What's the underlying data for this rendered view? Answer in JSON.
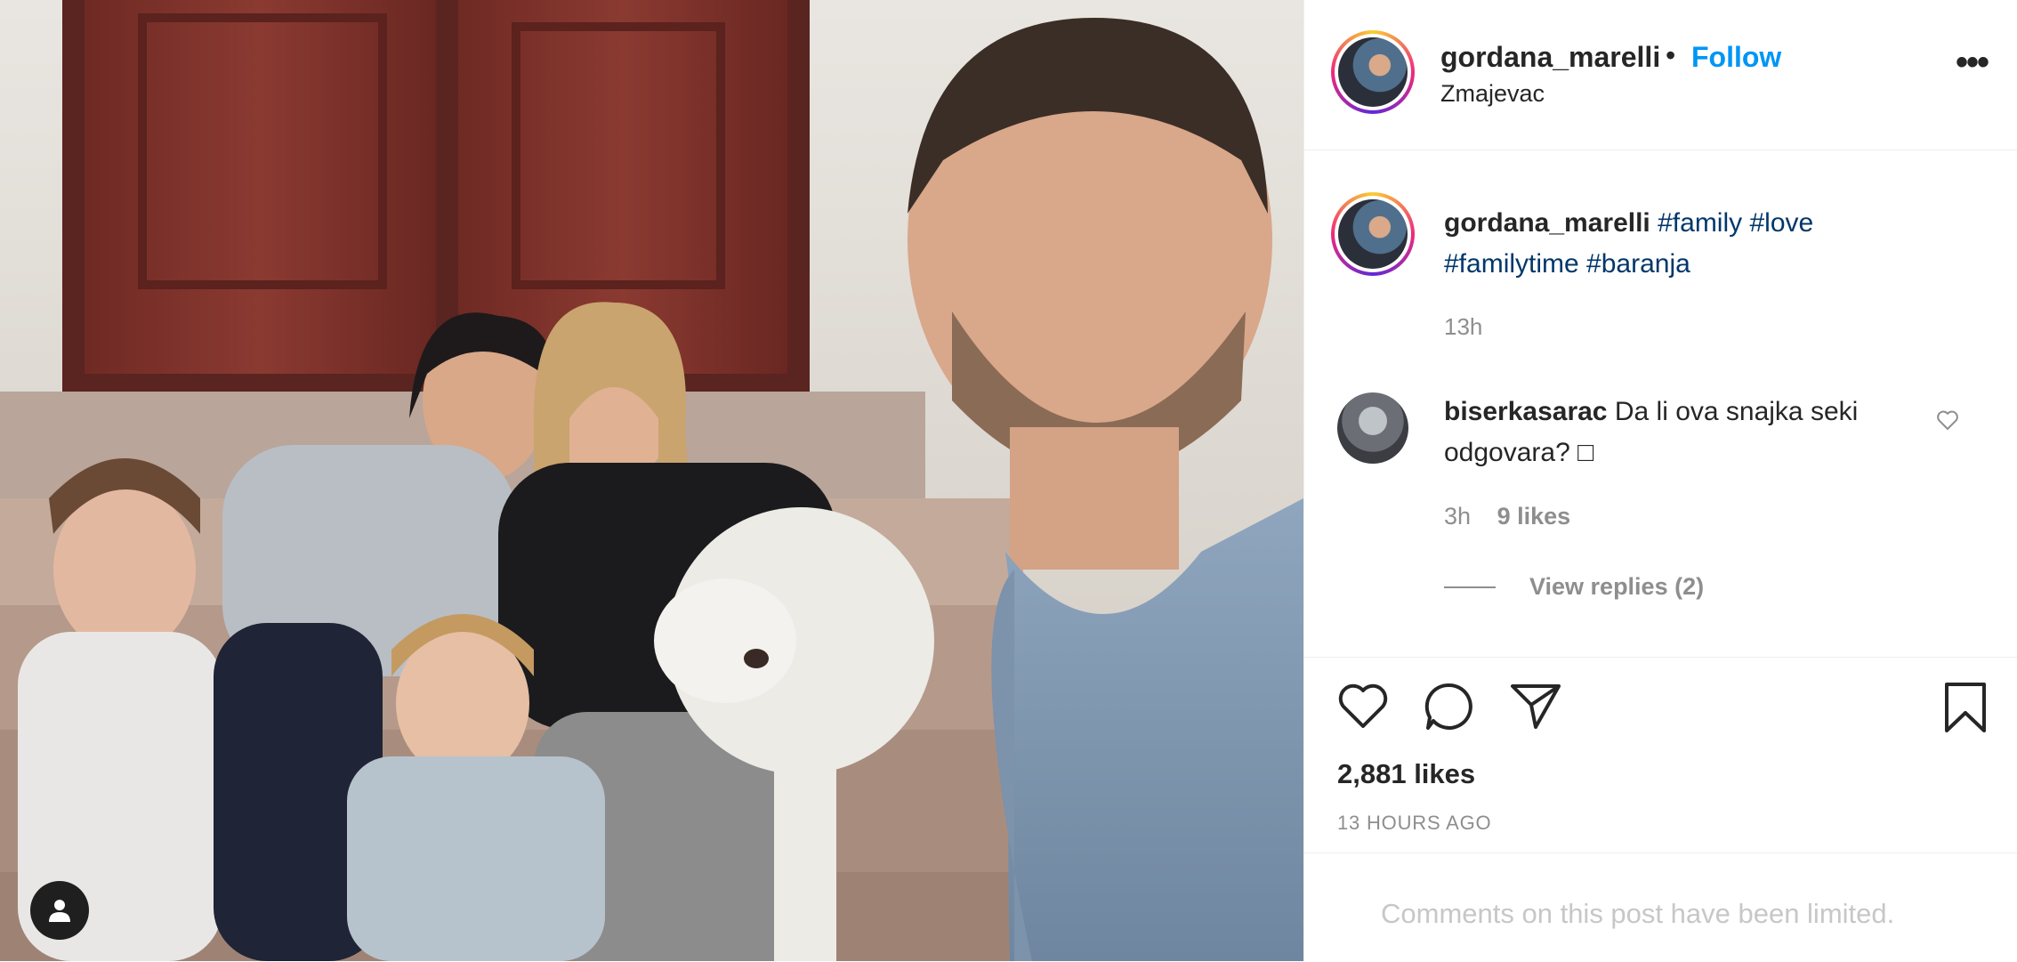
{
  "post": {
    "username": "gordana_marelli",
    "separator": "•",
    "follow_label": "Follow",
    "location": "Zmajevac",
    "more_label": "•••"
  },
  "caption": {
    "username": "gordana_marelli",
    "hashtags": [
      "#family",
      "#love",
      "#familytime",
      "#baranja"
    ],
    "time": "13h"
  },
  "comment": {
    "username": "biserkasarac",
    "text": "Da li ova snajka seki odgovara? □",
    "time": "3h",
    "likes": "9 likes",
    "view_replies": "View replies (2)"
  },
  "footer": {
    "likes": "2,881 likes",
    "timestamp": "13 HOURS AGO",
    "comments_limited": "Comments on this post have been limited."
  },
  "icons": {
    "like": "heart-icon",
    "comment": "comment-icon",
    "share": "share-icon",
    "save": "bookmark-icon",
    "tags": "person-tag-icon"
  },
  "colors": {
    "follow": "#0095f6",
    "hashtag": "#00376b",
    "secondary_text": "#8e8e8e"
  }
}
